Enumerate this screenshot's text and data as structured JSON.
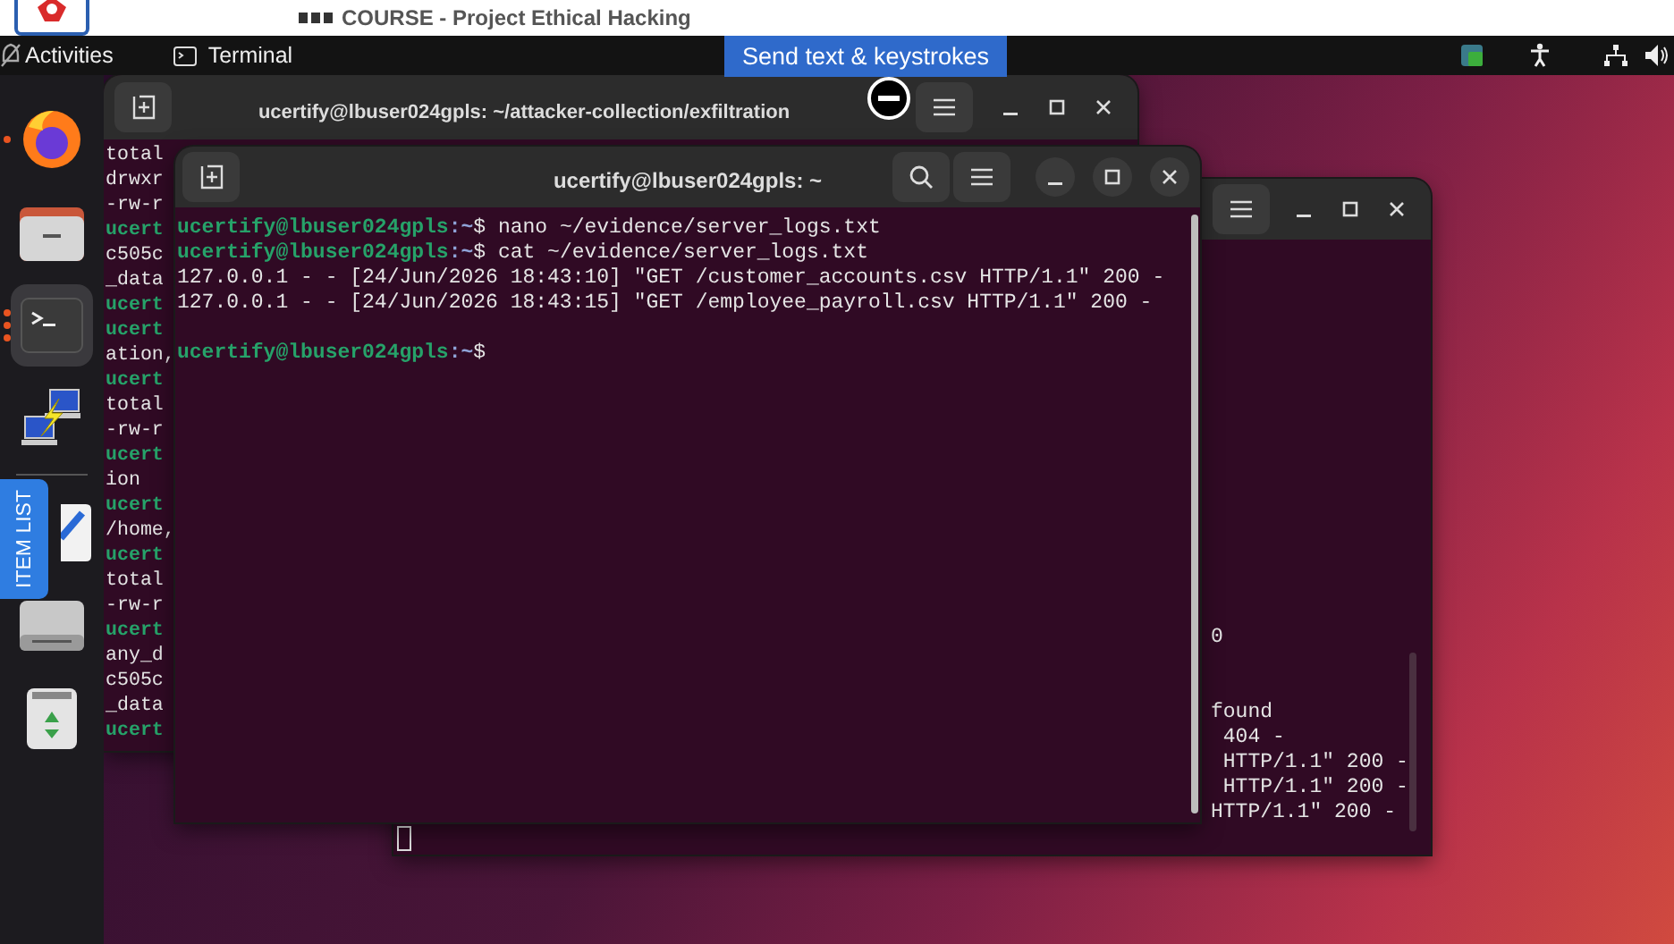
{
  "banner": {
    "title": "COURSE - Project Ethical Hacking"
  },
  "top_bar": {
    "activities": "Activities",
    "app_name": "Terminal"
  },
  "send_button": {
    "label": "Send text & keystrokes"
  },
  "item_list_tab": {
    "label": "ITEM LIST"
  },
  "dock": {
    "items": [
      {
        "kind": "browser",
        "running": true,
        "selected": false
      },
      {
        "kind": "files",
        "running": false,
        "selected": false
      },
      {
        "kind": "terminal",
        "running": true,
        "selected": true
      },
      {
        "kind": "network",
        "running": false,
        "selected": false
      },
      {
        "kind": "separator"
      },
      {
        "kind": "editor",
        "running": false,
        "selected": false
      },
      {
        "kind": "drive",
        "running": false,
        "selected": false
      },
      {
        "kind": "trash",
        "running": false,
        "selected": false
      }
    ]
  },
  "windows": [
    {
      "title": "ucertify@lbuser024gpls: ~/attacker-collection/exfiltration",
      "lines": [
        {
          "kind": "output",
          "text": "total"
        },
        {
          "kind": "output",
          "text": "drwxr"
        },
        {
          "kind": "output",
          "text": "-rw-r"
        },
        {
          "kind": "prompt",
          "user": "ucert"
        },
        {
          "kind": "output",
          "text": "c505c"
        },
        {
          "kind": "output",
          "text": "_data"
        },
        {
          "kind": "prompt",
          "user": "ucert"
        },
        {
          "kind": "prompt",
          "user": "ucert"
        },
        {
          "kind": "output",
          "text": "ation,"
        },
        {
          "kind": "prompt",
          "user": "ucert"
        },
        {
          "kind": "output",
          "text": "total"
        },
        {
          "kind": "output",
          "text": "-rw-r"
        },
        {
          "kind": "prompt",
          "user": "ucert"
        },
        {
          "kind": "output",
          "text": "ion"
        },
        {
          "kind": "prompt",
          "user": "ucert"
        },
        {
          "kind": "output",
          "text": "/home,"
        },
        {
          "kind": "prompt",
          "user": "ucert"
        },
        {
          "kind": "output",
          "text": "total"
        },
        {
          "kind": "output",
          "text": "-rw-r"
        },
        {
          "kind": "prompt",
          "user": "ucert"
        },
        {
          "kind": "output",
          "text": "any_d"
        },
        {
          "kind": "output",
          "text": "c505c"
        },
        {
          "kind": "output",
          "text": "_data"
        },
        {
          "kind": "prompt",
          "user": "ucert"
        }
      ]
    },
    {
      "lines": [
        {
          "kind": "output",
          "text": "0"
        },
        {
          "kind": "blank"
        },
        {
          "kind": "blank"
        },
        {
          "kind": "output",
          "text": "found"
        },
        {
          "kind": "output",
          "text": " 404 -"
        },
        {
          "kind": "output",
          "text": " HTTP/1.1\" 200 -"
        },
        {
          "kind": "output",
          "text": " HTTP/1.1\" 200 -"
        },
        {
          "kind": "output",
          "text": "HTTP/1.1\" 200 -"
        }
      ]
    },
    {
      "title": "ucertify@lbuser024gpls: ~",
      "lines": [
        {
          "kind": "prompt",
          "user": "ucertify@lbuser024gpls",
          "path": ":~",
          "command": "$ nano ~/evidence/server_logs.txt"
        },
        {
          "kind": "prompt",
          "user": "ucertify@lbuser024gpls",
          "path": ":~",
          "command": "$ cat ~/evidence/server_logs.txt"
        },
        {
          "kind": "output",
          "text": "127.0.0.1 - - [24/Jun/2026 18:43:10] \"GET /customer_accounts.csv HTTP/1.1\" 200 -"
        },
        {
          "kind": "output",
          "text": "127.0.0.1 - - [24/Jun/2026 18:43:15] \"GET /employee_payroll.csv HTTP/1.1\" 200 -"
        },
        {
          "kind": "blank"
        },
        {
          "kind": "prompt",
          "user": "ucertify@lbuser024gpls",
          "path": ":~",
          "command": "$"
        }
      ]
    }
  ]
}
